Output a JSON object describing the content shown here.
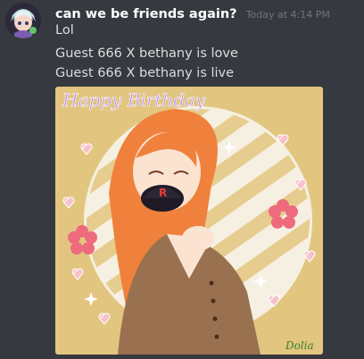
{
  "message": {
    "author": "can we be friends again?",
    "timestamp": "Today at 4:14 PM",
    "lines": [
      "Lol",
      "Guest 666 X bethany is love",
      "Guest 666 X bethany is live"
    ]
  },
  "attachment": {
    "title": "Happy Birthday",
    "signature": "Dolia",
    "badge_letter": "R"
  },
  "colors": {
    "background": "#36393f",
    "username": "#ffffff",
    "text": "#dcddde",
    "timestamp": "#72767d",
    "art_background": "#e2c680",
    "hair": "#f0813c",
    "shirt": "#9a7150",
    "title": "#b88cf0"
  },
  "icons": {
    "avatar": "avatar-drawing",
    "hat": "roblox-r-hat"
  }
}
